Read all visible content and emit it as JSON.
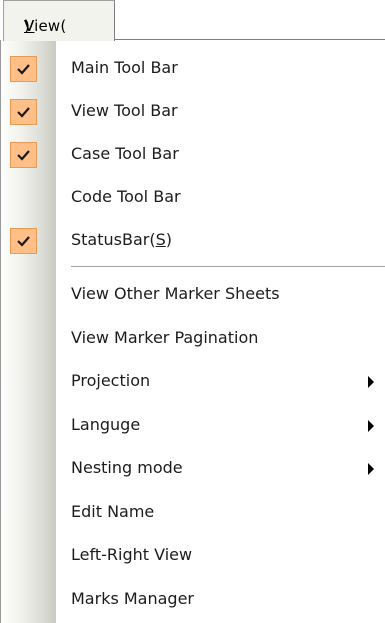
{
  "menu": {
    "title_prefix": "View(",
    "title_mnemonic": "V",
    "title_suffix": ")"
  },
  "items": [
    {
      "label": "Main Tool Bar",
      "checked": true
    },
    {
      "label": "View Tool Bar",
      "checked": true
    },
    {
      "label": "Case Tool Bar",
      "checked": true
    },
    {
      "label": "Code Tool Bar",
      "checked": false
    },
    {
      "label_prefix": "StatusBar(",
      "label_mnemonic": "S",
      "label_suffix": ")",
      "checked": true
    },
    {
      "label": "View Other Marker Sheets"
    },
    {
      "label": "View Marker Pagination"
    },
    {
      "label": "Projection",
      "submenu": true
    },
    {
      "label": "Languge",
      "submenu": true
    },
    {
      "label": "Nesting mode",
      "submenu": true
    },
    {
      "label": "Edit Name"
    },
    {
      "label": "Left-Right View"
    },
    {
      "label": "Marks Manager"
    }
  ],
  "colors": {
    "check_fill": "#ffbf87",
    "check_border": "#e69a55",
    "check_mark": "#1a1a1a"
  }
}
